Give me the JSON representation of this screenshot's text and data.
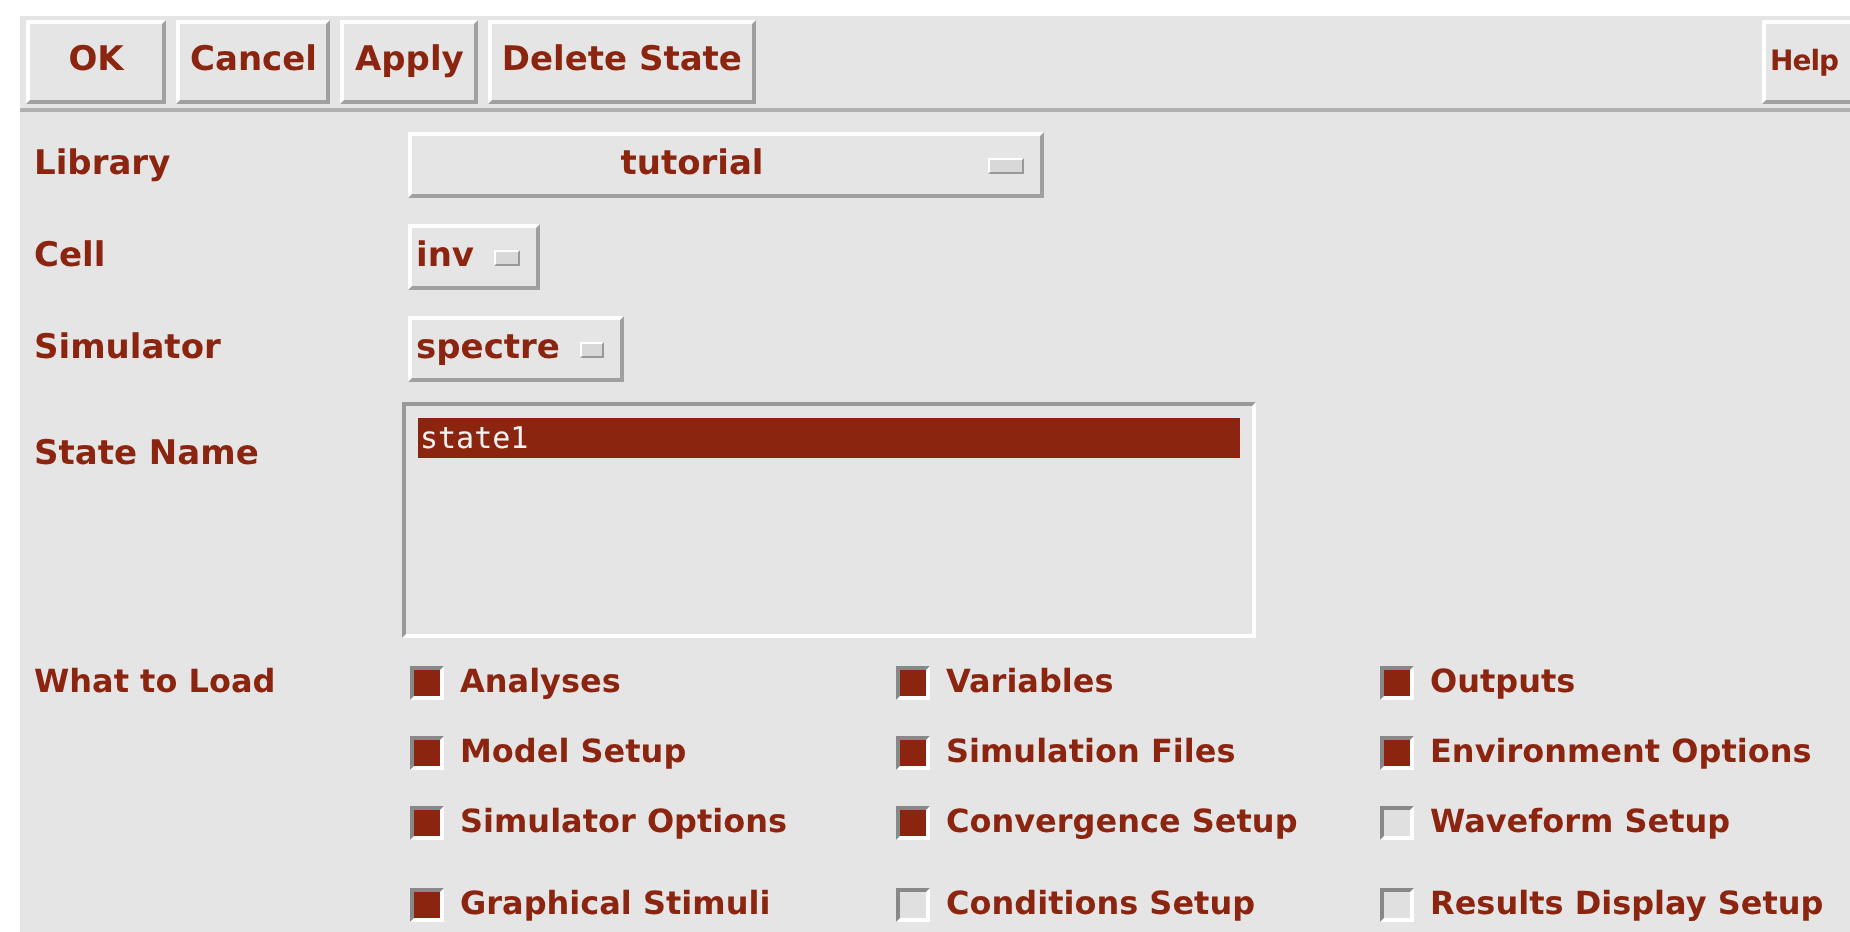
{
  "toolbar": {
    "buttons": [
      "OK",
      "Cancel",
      "Apply",
      "Delete State"
    ],
    "help": "Help"
  },
  "library": {
    "label": "Library",
    "value": "tutorial"
  },
  "cell": {
    "label": "Cell",
    "value": "inv"
  },
  "simulator": {
    "label": "Simulator",
    "value": "spectre"
  },
  "state_name": {
    "label": "State Name",
    "items": [
      {
        "text": "state1",
        "selected": true
      }
    ]
  },
  "what_to_load": {
    "label": "What to Load",
    "options": [
      {
        "label": "Analyses",
        "checked": true
      },
      {
        "label": "Variables",
        "checked": true
      },
      {
        "label": "Outputs",
        "checked": true
      },
      {
        "label": "Model Setup",
        "checked": true
      },
      {
        "label": "Simulation Files",
        "checked": true
      },
      {
        "label": "Environment Options",
        "checked": true
      },
      {
        "label": "Simulator Options",
        "checked": true
      },
      {
        "label": "Convergence Setup",
        "checked": true
      },
      {
        "label": "Waveform Setup",
        "checked": false
      },
      {
        "label": "Graphical Stimuli",
        "checked": true
      },
      {
        "label": "Conditions Setup",
        "checked": false
      },
      {
        "label": "Results Display Setup",
        "checked": false
      }
    ]
  }
}
